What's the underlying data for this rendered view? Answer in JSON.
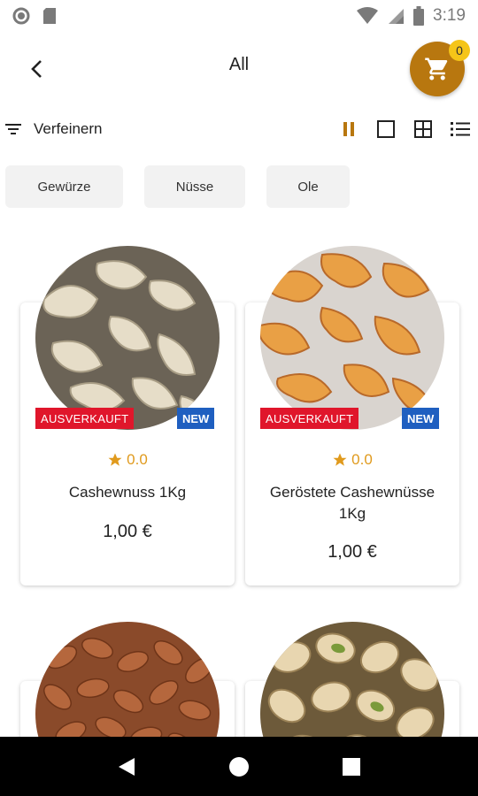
{
  "status_bar": {
    "time": "3:19",
    "icons": [
      "circle-status-icon",
      "sd-card-icon",
      "wifi-icon",
      "signal-icon",
      "battery-icon"
    ]
  },
  "app_bar": {
    "title": "All",
    "back_icon": "chevron-left-icon",
    "cart_icon": "shopping-cart-icon",
    "cart_count": "0",
    "cart_color": "#b8770f"
  },
  "filter": {
    "refine_label": "Verfeinern",
    "view_icons": [
      "pause-icon",
      "single-square-icon",
      "grid-icon",
      "list-icon"
    ],
    "active_view": "pause-icon"
  },
  "categories": [
    "Gewürze",
    "Nüsse",
    "Ole"
  ],
  "products": [
    {
      "name": "Cashewnuss 1Kg",
      "rating": "0.0",
      "price": "1,00 €",
      "badge_sold": "AUSVERKAUFT",
      "badge_new": "NEW",
      "image": "raw-cashews"
    },
    {
      "name": "Geröstete Cashewnüsse 1Kg",
      "rating": "0.0",
      "price": "1,00 €",
      "badge_sold": "AUSVERKAUFT",
      "badge_new": "NEW",
      "image": "roasted-cashews"
    },
    {
      "image": "almonds"
    },
    {
      "image": "pistachios"
    }
  ],
  "nav_bar": {
    "icons": [
      "back-triangle-icon",
      "home-circle-icon",
      "recents-square-icon"
    ]
  },
  "colors": {
    "accent": "#b8770f",
    "badge_sold": "#e0162b",
    "badge_new": "#1f5fc0",
    "star": "#e09a1d"
  }
}
